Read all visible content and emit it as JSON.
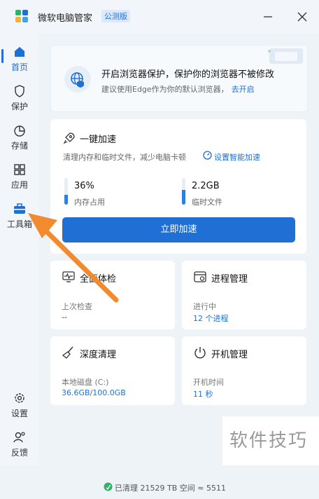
{
  "app": {
    "title": "微软电脑管家",
    "badge": "公测版"
  },
  "window": {
    "minimize_icon": "minimize-icon",
    "close_icon": "close-icon"
  },
  "sidebar": {
    "items": [
      {
        "label": "首页",
        "icon": "home-icon",
        "active": true
      },
      {
        "label": "保护",
        "icon": "shield-icon"
      },
      {
        "label": "存储",
        "icon": "pie-chart-icon"
      },
      {
        "label": "应用",
        "icon": "apps-icon"
      },
      {
        "label": "工具箱",
        "icon": "toolbox-icon"
      }
    ],
    "bottom": [
      {
        "label": "设置",
        "icon": "gear-icon"
      },
      {
        "label": "反馈",
        "icon": "feedback-icon"
      }
    ]
  },
  "browser_card": {
    "title": "开启浏览器保护，保护你的浏览器不被修改",
    "subtitle": "建议使用Edge作为你的默认浏览器，",
    "link": "去开启"
  },
  "speed_card": {
    "title": "一键加速",
    "subtitle": "清理内存和临时文件，减少电脑卡顿",
    "smart_link": "设置智能加速",
    "memory": {
      "value": "36%",
      "label": "内存占用",
      "level": 0.36
    },
    "temp": {
      "value": "2.2GB",
      "label": "临时文件",
      "level": 0.55
    },
    "button": "立即加速"
  },
  "tiles": {
    "check": {
      "title": "全面体检",
      "sub": "上次检查",
      "value": "--"
    },
    "process": {
      "title": "进程管理",
      "sub": "进行中",
      "value": "12 个进程"
    },
    "clean": {
      "title": "深度清理",
      "sub": "本地磁盘 (C:)",
      "value": "36.6GB/100.0GB"
    },
    "boot": {
      "title": "开机管理",
      "sub": "开机时间",
      "value": "11 秒"
    }
  },
  "footer": {
    "text": "已清理 21529 TB 空间 ≈ 5511"
  },
  "watermark": {
    "text": "软件技巧"
  },
  "colors": {
    "accent": "#1f6fd4",
    "annotation_arrow": "#f28a2e"
  }
}
